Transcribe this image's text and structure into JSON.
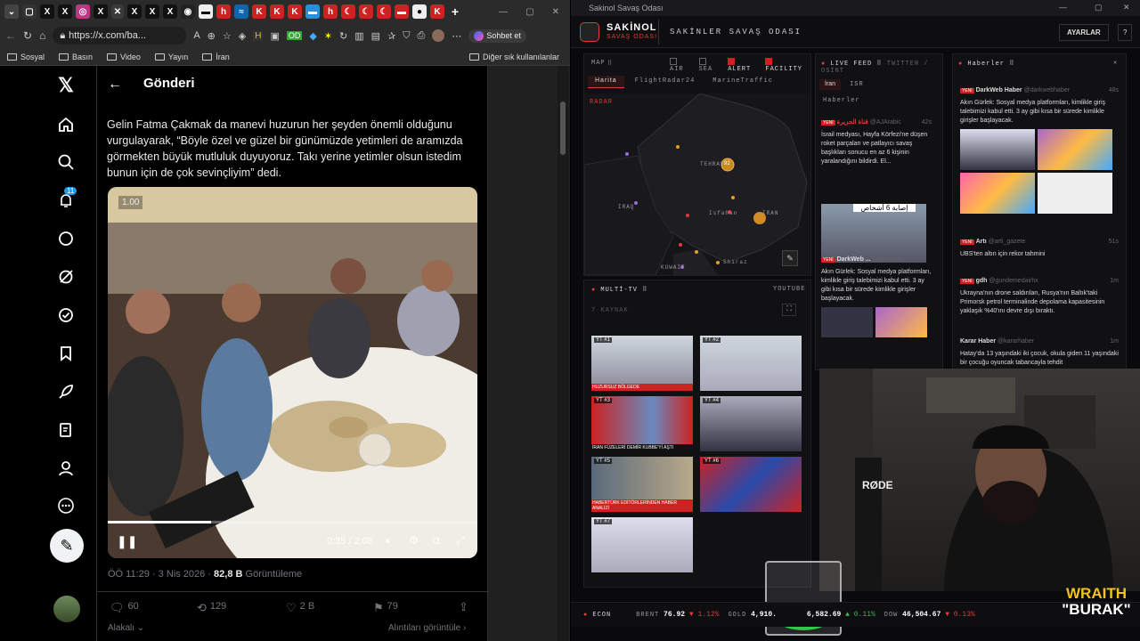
{
  "left": {
    "url": "https://x.com/ba...",
    "sohbet": "Sohbet et",
    "bookmarks": [
      "Sosyal",
      "Basın",
      "Video",
      "Yayın",
      "İran"
    ],
    "bookmark_other": "Diğer sık kullanılanlar",
    "notif_badge": "11",
    "post_header": "Gönderi",
    "post_text": "Gelin Fatma Çakmak da manevi huzurun her şeyden önemli olduğunu vurgulayarak, “Böyle özel ve güzel bir günümüzde yetimleri de aramızda görmekten büyük mutluluk duyuyoruz. Takı yerine yetimler olsun istedim bunun için de çok sevinçliyim” dedi.",
    "video_speed": "1.00",
    "video_time": "0:35 / 2:08",
    "video_progress": 0.28,
    "post_time": "ÖÖ 11:29 · 3 Nis 2026 · ",
    "views_num": "82,8 B",
    "views_label": "Görüntüleme",
    "replies": "60",
    "reposts": "129",
    "likes": "2 B",
    "bookmarks_count": "79",
    "footer_left": "Alakalı",
    "footer_right": "Alıntıları görüntüle"
  },
  "right": {
    "window_title": "Sakinol Savaş Odası",
    "brand": "SAKİNOL",
    "brand_sub": "SAVAŞ ODASI",
    "app_title": "SAKİNLER SAVAŞ ODASI",
    "settings": "AYARLAR",
    "help": "?",
    "map_label": "MAP",
    "filters": [
      {
        "label": "AIR",
        "checked": false
      },
      {
        "label": "SEA",
        "checked": false
      },
      {
        "label": "ALERT",
        "checked": true
      },
      {
        "label": "FACILITY",
        "checked": true
      }
    ],
    "map_tabs": [
      "Harita",
      "FlightRadar24",
      "MarineTraffic"
    ],
    "radar": "RADAR",
    "map_places": [
      "TEHRAN",
      "IRAQ",
      "Isfahan",
      "IRAN",
      "Shiraz",
      "KUWAIT"
    ],
    "cluster": "92",
    "live_feed": "LIVE FEED",
    "live_feed_sub": "TWITTER / OSINT",
    "feed_tabs": [
      "İran",
      "ISR"
    ],
    "feed_tab2": "Haberler",
    "feed_items": [
      {
        "badge": "YENİ",
        "source": "قناة الجزيرة",
        "handle": "@AJArabic",
        "time": "42s",
        "text": "İsrail medyası, Hayfa Körfezi'ne düşen roket parçaları ve patlayıcı savaş başlıkları sonucu en az 6 kişinin yaralandığını bildirdi. El...",
        "caption": "إصابة 6 أشخاص"
      },
      {
        "badge": "YENİ",
        "source": "DarkWeb ...",
        "handle": "@darkweb...",
        "time": "48s",
        "text": "Akın Gürlek: Sosyal medya platformları, kimlikle giriş talebimizi kabul etti. 3 ay gibi kısa bir sürede kimlikle girişler başlayacak."
      }
    ],
    "haberler": "Haberler",
    "news_items": [
      {
        "badge": "YENİ",
        "source": "DarkWeb Haber",
        "handle": "@darkwebhaber",
        "time": "48s",
        "text": "Akın Gürlek: Sosyal medya platformları, kimlikle giriş talebimizi kabul etti. 3 ay gibi kısa bir sürede kimlikle girişler başlayacak."
      },
      {
        "badge": "YENİ",
        "source": "Artı",
        "handle": "@arti_gazete",
        "time": "51s",
        "text": "UBS'ten altın için rekor tahmini"
      },
      {
        "badge": "YENİ",
        "source": "gdh",
        "handle": "@gundemedairhx",
        "time": "1m",
        "text": "Ukrayna'nın drone saldırıları, Rusya'nın Baltık'taki Primorsk petrol terminalinde depolama kapasitesinin yaklaşık %40'ını devre dışı bıraktı."
      },
      {
        "badge": "",
        "source": "Karar Haber",
        "handle": "@kararhaber",
        "time": "1m",
        "text": "Hatay'da 13 yaşındaki iki çocuk, okula giden 11 yaşındaki bir çocuğu oyuncak tabancayla tehdit"
      }
    ],
    "multitv": "MULTİ-TV",
    "multitv_sub": "YOUTUBE",
    "kaynak": "7 KAYNAK",
    "tv_labels": [
      "YT #1",
      "YT #2",
      "YT #3",
      "YT #4",
      "YT #5",
      "YT #6",
      "YT #7"
    ],
    "tv_captions": [
      "HUZURSUZ BÖLGEDE",
      "",
      "İRAN FÜZELERİ DEMİR KUBBE'Yİ AŞTI",
      "",
      "HABERTÜRK EDİTÖRLERİNDEN HABER ANALİZİ",
      "",
      ""
    ],
    "econ": "ECON",
    "ticker": [
      {
        "name": "BRENT",
        "value": "76.92",
        "change": "▼ 1.12%",
        "color": "#e03a3a"
      },
      {
        "name": "GOLD",
        "value": "4,910.",
        "change": "",
        "color": "#e03a3a"
      },
      {
        "name": "",
        "value": "6,582.69",
        "change": "▲ 0.11%",
        "color": "#2fbf4f"
      },
      {
        "name": "DOW",
        "value": "46,504.67",
        "change": "▼ 0.13%",
        "color": "#e03a3a"
      }
    ],
    "rode": "RØDE",
    "streamer_top": "WRAITH",
    "streamer_bottom": "\"BURAK\""
  }
}
